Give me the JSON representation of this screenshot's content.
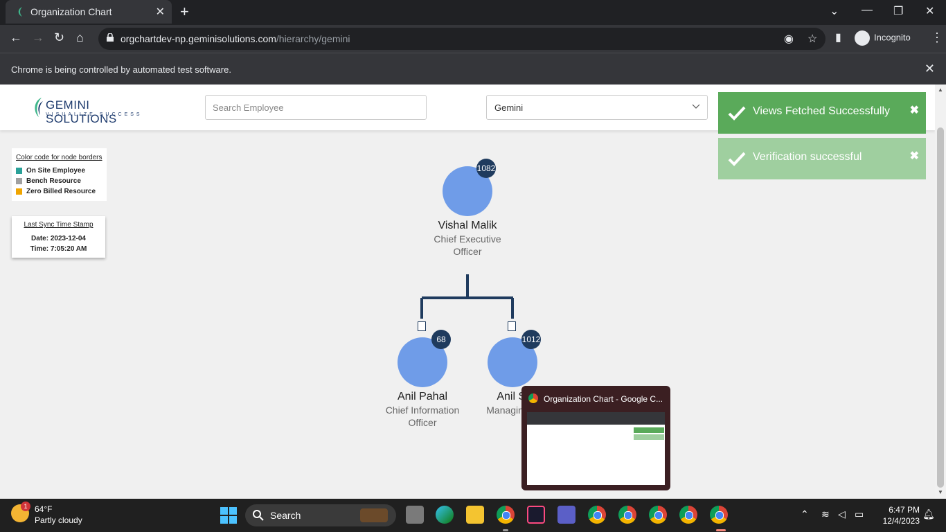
{
  "browser": {
    "tab_title": "Organization Chart",
    "url_host": "orgchartdev-np.geminisolutions.com",
    "url_path": "/hierarchy/gemini",
    "profile_label": "Incognito",
    "infobar_message": "Chrome is being controlled by automated test software."
  },
  "header": {
    "brand_name": "GEMINI SOLUTIONS",
    "brand_tagline": "VISUALIZE SUCCESS",
    "search_placeholder": "Search Employee",
    "org_select_value": "Gemini"
  },
  "legend": {
    "title": "Color code for node borders",
    "items": [
      {
        "label": "On Site Employee",
        "color": "#2aa198"
      },
      {
        "label": "Bench Resource",
        "color": "#a0a0a0"
      },
      {
        "label": "Zero Billed Resource",
        "color": "#f0a500"
      }
    ]
  },
  "sync": {
    "title": "Last Sync Time Stamp",
    "date": "Date: 2023-12-04",
    "time": "Time: 7:05:20 AM"
  },
  "org": {
    "root": {
      "name": "Vishal Malik",
      "role": "Chief Executive Officer",
      "count": "1082"
    },
    "children": [
      {
        "name": "Anil Pahal",
        "role": "Chief Information Officer",
        "count": "68"
      },
      {
        "name": "Anil Si",
        "role": "Managing D",
        "count": "1012"
      }
    ]
  },
  "toasts": [
    {
      "message": "Views Fetched Successfully",
      "color": "#5aaa5a"
    },
    {
      "message": "Verification successful",
      "color": "#9fcf9f"
    }
  ],
  "preview": {
    "title": "Organization Chart - Google C..."
  },
  "taskbar": {
    "weather_temp": "64°F",
    "weather_desc": "Partly cloudy",
    "weather_badge": "1",
    "search_label": "Search",
    "time": "6:47 PM",
    "date": "12/4/2023"
  }
}
